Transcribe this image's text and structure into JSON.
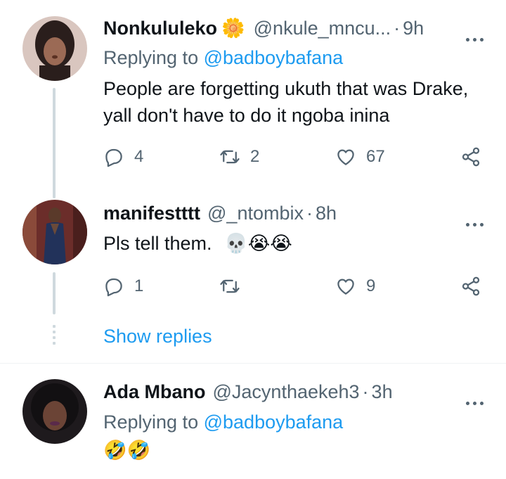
{
  "tweets": [
    {
      "name": "Nonkululeko",
      "name_emoji": "🌼",
      "handle": "@nkule_mncu...",
      "time": "9h",
      "replying_label": "Replying to",
      "replying_mention": "@badboybafana",
      "body_lines": [
        "People are forgetting ukuth that was Drake,",
        "yall don't have to do it ngoba inina"
      ],
      "replies": "4",
      "retweets": "2",
      "likes": "67"
    },
    {
      "name": "manifestttt",
      "handle": "@_ntombix",
      "time": "8h",
      "body_text": "Pls tell them.",
      "body_emojis": "💀😭😭",
      "replies": "1",
      "retweets": "",
      "likes": "9"
    },
    {
      "name": "Ada Mbano",
      "handle": "@Jacynthaekeh3",
      "time": "3h",
      "replying_label": "Replying to",
      "replying_mention": "@badboybafana",
      "body_emojis": "🤣🤣"
    }
  ],
  "show_replies_label": "Show replies",
  "separator": "·",
  "icons": {
    "reply": "reply-icon",
    "retweet": "retweet-icon",
    "like": "heart-icon",
    "share": "share-icon",
    "more": "more-icon"
  },
  "colors": {
    "text": "#0f1419",
    "secondary": "#536471",
    "accent": "#1d9bf0",
    "thread_line": "#cfd9de"
  }
}
